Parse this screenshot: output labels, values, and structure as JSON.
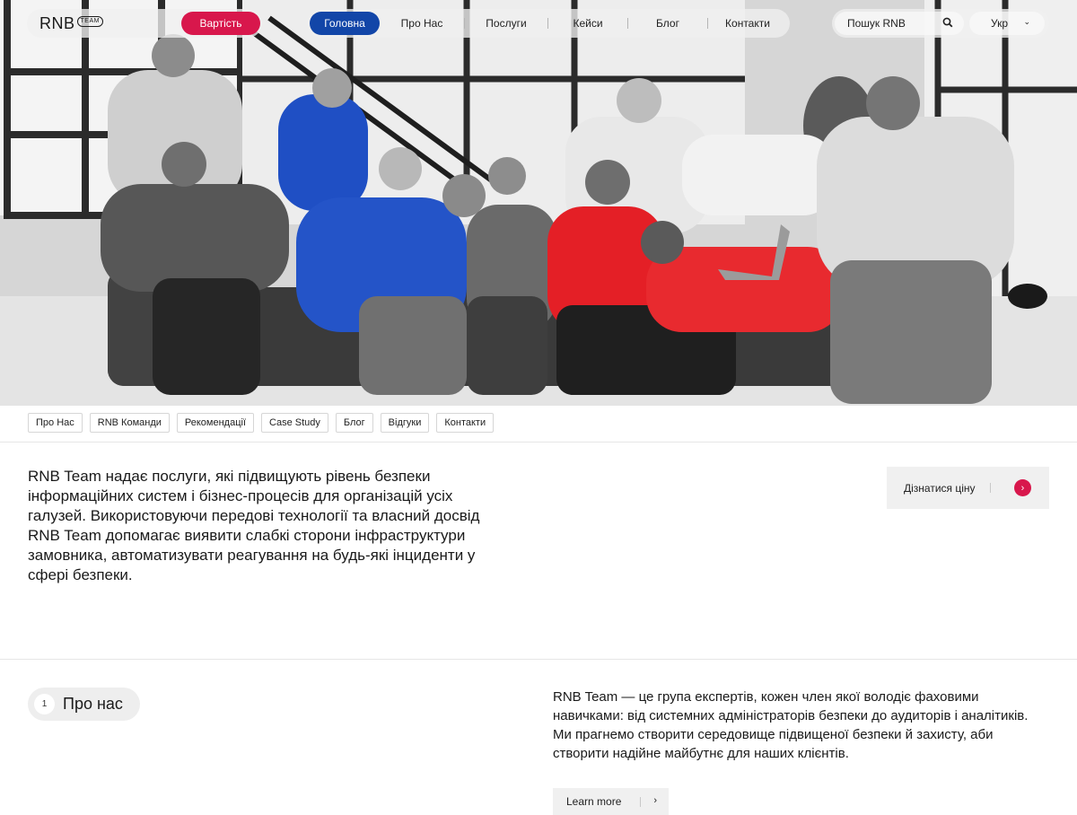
{
  "header": {
    "logo_text": "RNB",
    "logo_badge": "TEAM",
    "price_button": "Вартість",
    "nav": [
      {
        "label": "Головна",
        "active": true
      },
      {
        "label": "Про Нас"
      },
      {
        "label": "Послуги"
      },
      {
        "label": "Кейси"
      },
      {
        "label": "Блог"
      },
      {
        "label": "Контакти"
      }
    ],
    "search_placeholder": "Пошук RNB",
    "language": "Укр"
  },
  "hero": {
    "image_alt": "Команда RNB Team на дивані"
  },
  "subnav": [
    "Про Нас",
    "RNB Команди",
    "Рекомендації",
    "Case Study",
    "Блог",
    "Відгуки",
    "Контакти"
  ],
  "intro": {
    "text": "RNB Team надає послуги, які підвищують рівень безпеки інформаційних систем і бізнес-процесів для організацій усіх галузей. Використовуючи передові технології та власний досвід RNB Team допомагає виявити слабкі сторони інфраструктури замовника, автоматизувати реагування на будь-які інциденти у сфері безпеки.",
    "cta_label": "Дізнатися ціну"
  },
  "about": {
    "number": "1",
    "label": "Про нас",
    "text": "RNB Team  — це група експертів, кожен член якої володіє фаховими навичками: від системних адміністраторів безпеки до аудиторів і аналітиків. Ми прагнемо створити середовище підвищеної безпеки й захисту, аби створити надійне майбутнє для наших клієнтів.",
    "learn_more": "Learn more"
  },
  "colors": {
    "accent_red": "#d8174c",
    "accent_blue": "#1246a8",
    "chip_border": "#d6d6d6",
    "panel_bg": "#f0f0f0"
  },
  "icons": [
    "search-icon",
    "chevron-down-icon",
    "arrow-right-icon"
  ]
}
